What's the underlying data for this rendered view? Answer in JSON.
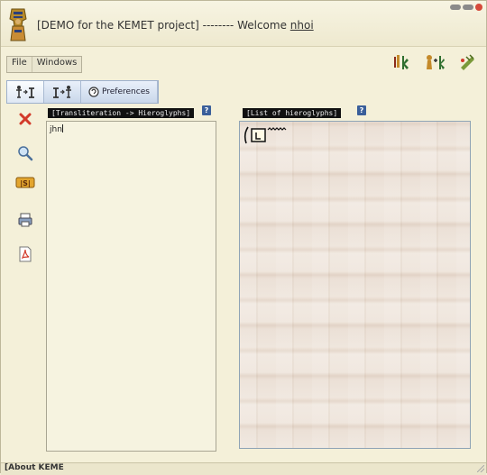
{
  "window": {
    "title_prefix": "[DEMO for the KEMET project] -------- Welcome ",
    "username": "nhoi"
  },
  "menu": {
    "file_label": "File",
    "windows_label": "Windows"
  },
  "tabs": [
    {
      "label": "",
      "icon": "hieroglyph-to-latin-icon"
    },
    {
      "label": "",
      "icon": "latin-to-hieroglyph-icon"
    },
    {
      "label": "Preferences",
      "icon": "preferences-icon"
    }
  ],
  "side_actions": [
    {
      "name": "delete",
      "icon": "delete-icon"
    },
    {
      "name": "search",
      "icon": "search-icon"
    },
    {
      "name": "sign",
      "icon": "sign-icon",
      "text": "|S|"
    },
    {
      "name": "print",
      "icon": "print-icon"
    },
    {
      "name": "pdf",
      "icon": "pdf-icon"
    }
  ],
  "transliteration_panel": {
    "label": "[Transliteration -> Hieroglyphs]",
    "value": "jhn"
  },
  "hieroglyph_panel": {
    "label": "[List of hieroglyphs]"
  },
  "statusbar": {
    "text": "[About KEME"
  },
  "colors": {
    "background": "#f4f0d9",
    "tab_bar": "#c9d7ea",
    "help_icon": "#3a5f9a",
    "delete": "#d23a2a"
  }
}
